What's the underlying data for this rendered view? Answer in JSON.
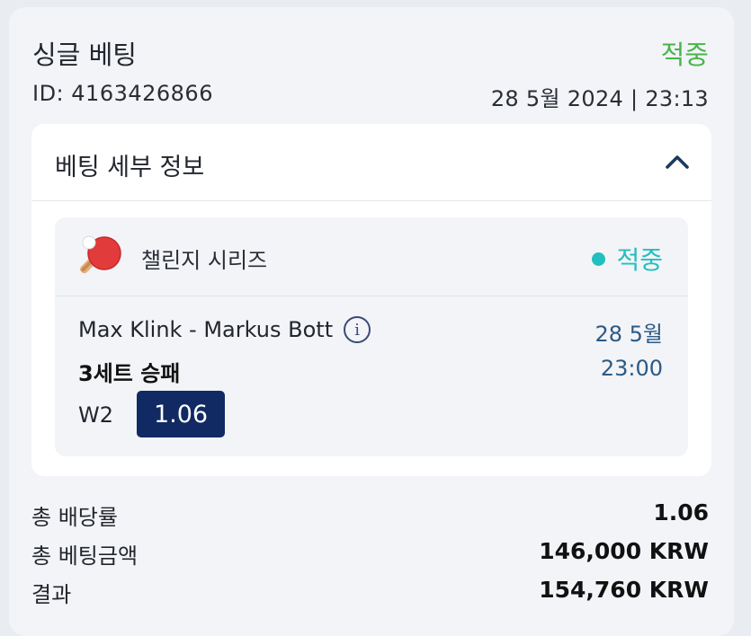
{
  "bet": {
    "type": "싱글 베팅",
    "status": "적중",
    "id": "ID: 4163426866",
    "datetime": "28 5월 2024 | 23:13"
  },
  "details": {
    "title": "베팅 세부 정보",
    "collapse_icon": "chevron-up-icon"
  },
  "event": {
    "sport_icon": "table-tennis-icon",
    "tournament": "챌린지 시리즈",
    "status": "적중",
    "match": "Max Klink - Markus Bott",
    "info_icon": "info-icon",
    "date": "28 5월",
    "time": "23:00",
    "market": "3세트 승패",
    "selection": "W2",
    "odds": "1.06"
  },
  "summary": {
    "total_odds_label": "총 배당률",
    "total_odds_value": "1.06",
    "stake_label": "총 베팅금액",
    "stake_value": "146,000 KRW",
    "result_label": "결과",
    "result_value": "154,760 KRW"
  },
  "colors": {
    "won_green": "#47b54b",
    "won_teal": "#22bfbf",
    "odds_badge": "#112a63",
    "date_blue": "#2c5a85"
  }
}
